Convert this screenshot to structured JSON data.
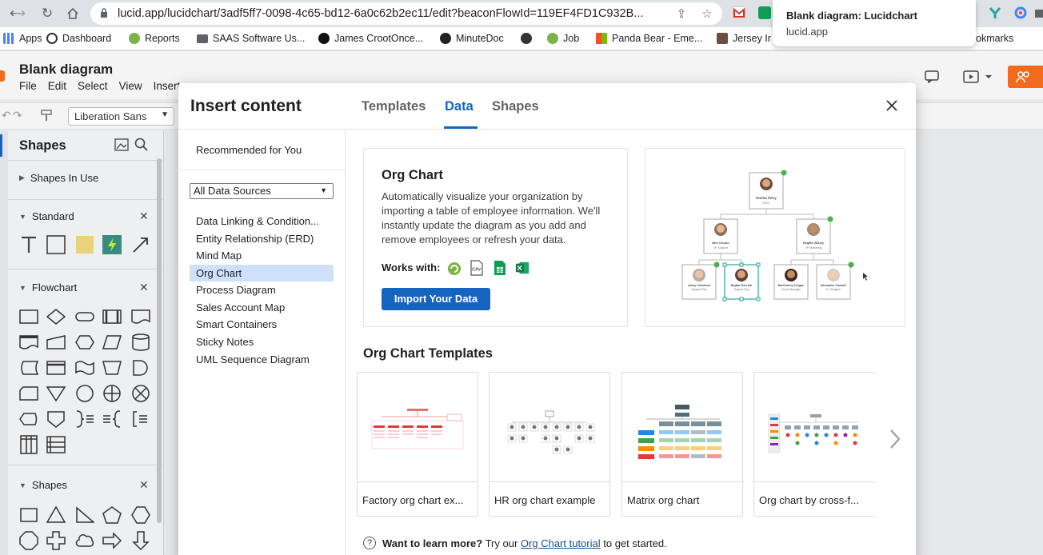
{
  "browser": {
    "url": "lucid.app/lucidchart/3adf5ff7-0098-4c65-bd12-6a0c62b2ec11/edit?beaconFlowId=119EF4FD1C932B...",
    "tooltip_title": "Blank diagram: Lucidchart",
    "tooltip_host": "lucid.app",
    "bookmarks": [
      "Apps",
      "Dashboard",
      "Reports",
      "SAAS Software Us...",
      "James CrootOnce...",
      "MinuteDoc",
      "Job",
      "Panda Bear - Eme...",
      "Jersey Ir"
    ],
    "bookmarks_overflow": "okmarks"
  },
  "app": {
    "doc_title": "Blank diagram",
    "menu": [
      "File",
      "Edit",
      "Select",
      "View",
      "Insert"
    ],
    "font_value": "Liberation Sans",
    "shapes_title": "Shapes",
    "sections": {
      "in_use": "Shapes In Use",
      "standard": "Standard",
      "flowchart": "Flowchart",
      "shapes": "Shapes"
    }
  },
  "modal": {
    "title": "Insert content",
    "tabs": [
      "Templates",
      "Data",
      "Shapes"
    ],
    "active_tab": "Data",
    "recommended": "Recommended for You",
    "data_source": "All Data Sources",
    "categories": [
      "Data Linking & Condition...",
      "Entity Relationship (ERD)",
      "Mind Map",
      "Org Chart",
      "Process Diagram",
      "Sales Account Map",
      "Smart Containers",
      "Sticky Notes",
      "UML Sequence Diagram"
    ],
    "selected_category": "Org Chart",
    "feature": {
      "title": "Org Chart",
      "description": "Automatically visualize your organization by importing a table of employee information. We'll instantly update the diagram as you add and remove employees or refresh your data.",
      "works_with": "Works with:",
      "import_button": "Import Your Data"
    },
    "preview": {
      "ceo_name": "Norma Perry",
      "ceo_role": "CEO",
      "vp1_name": "Bert Orozko",
      "vp1_role": "VP Support",
      "vp2_name": "Brigitte Withey",
      "vp2_role": "VP Marketing",
      "staff": [
        {
          "name": "Laney Christmas",
          "role": "Support Rep"
        },
        {
          "name": "Brigitte Rennick",
          "role": "Support Rep"
        },
        {
          "name": "Bartholemy Durgan",
          "role": "Social Manager"
        },
        {
          "name": "Bernadine Gadwell",
          "role": "Sr. Designer"
        }
      ]
    },
    "templates_heading": "Org Chart Templates",
    "templates": [
      {
        "label": "Factory org chart ex..."
      },
      {
        "label": "HR org chart example"
      },
      {
        "label": "Matrix org chart"
      },
      {
        "label": "Org chart by cross-f..."
      }
    ],
    "learn_bold": "Want to learn more?",
    "learn_pre": "Try our",
    "learn_link": "Org Chart tutorial",
    "learn_post": "to get started."
  },
  "colors": {
    "accent": "#1565c0",
    "selected_bg": "#cfe0fa",
    "lucid_orange": "#f26b1d"
  }
}
